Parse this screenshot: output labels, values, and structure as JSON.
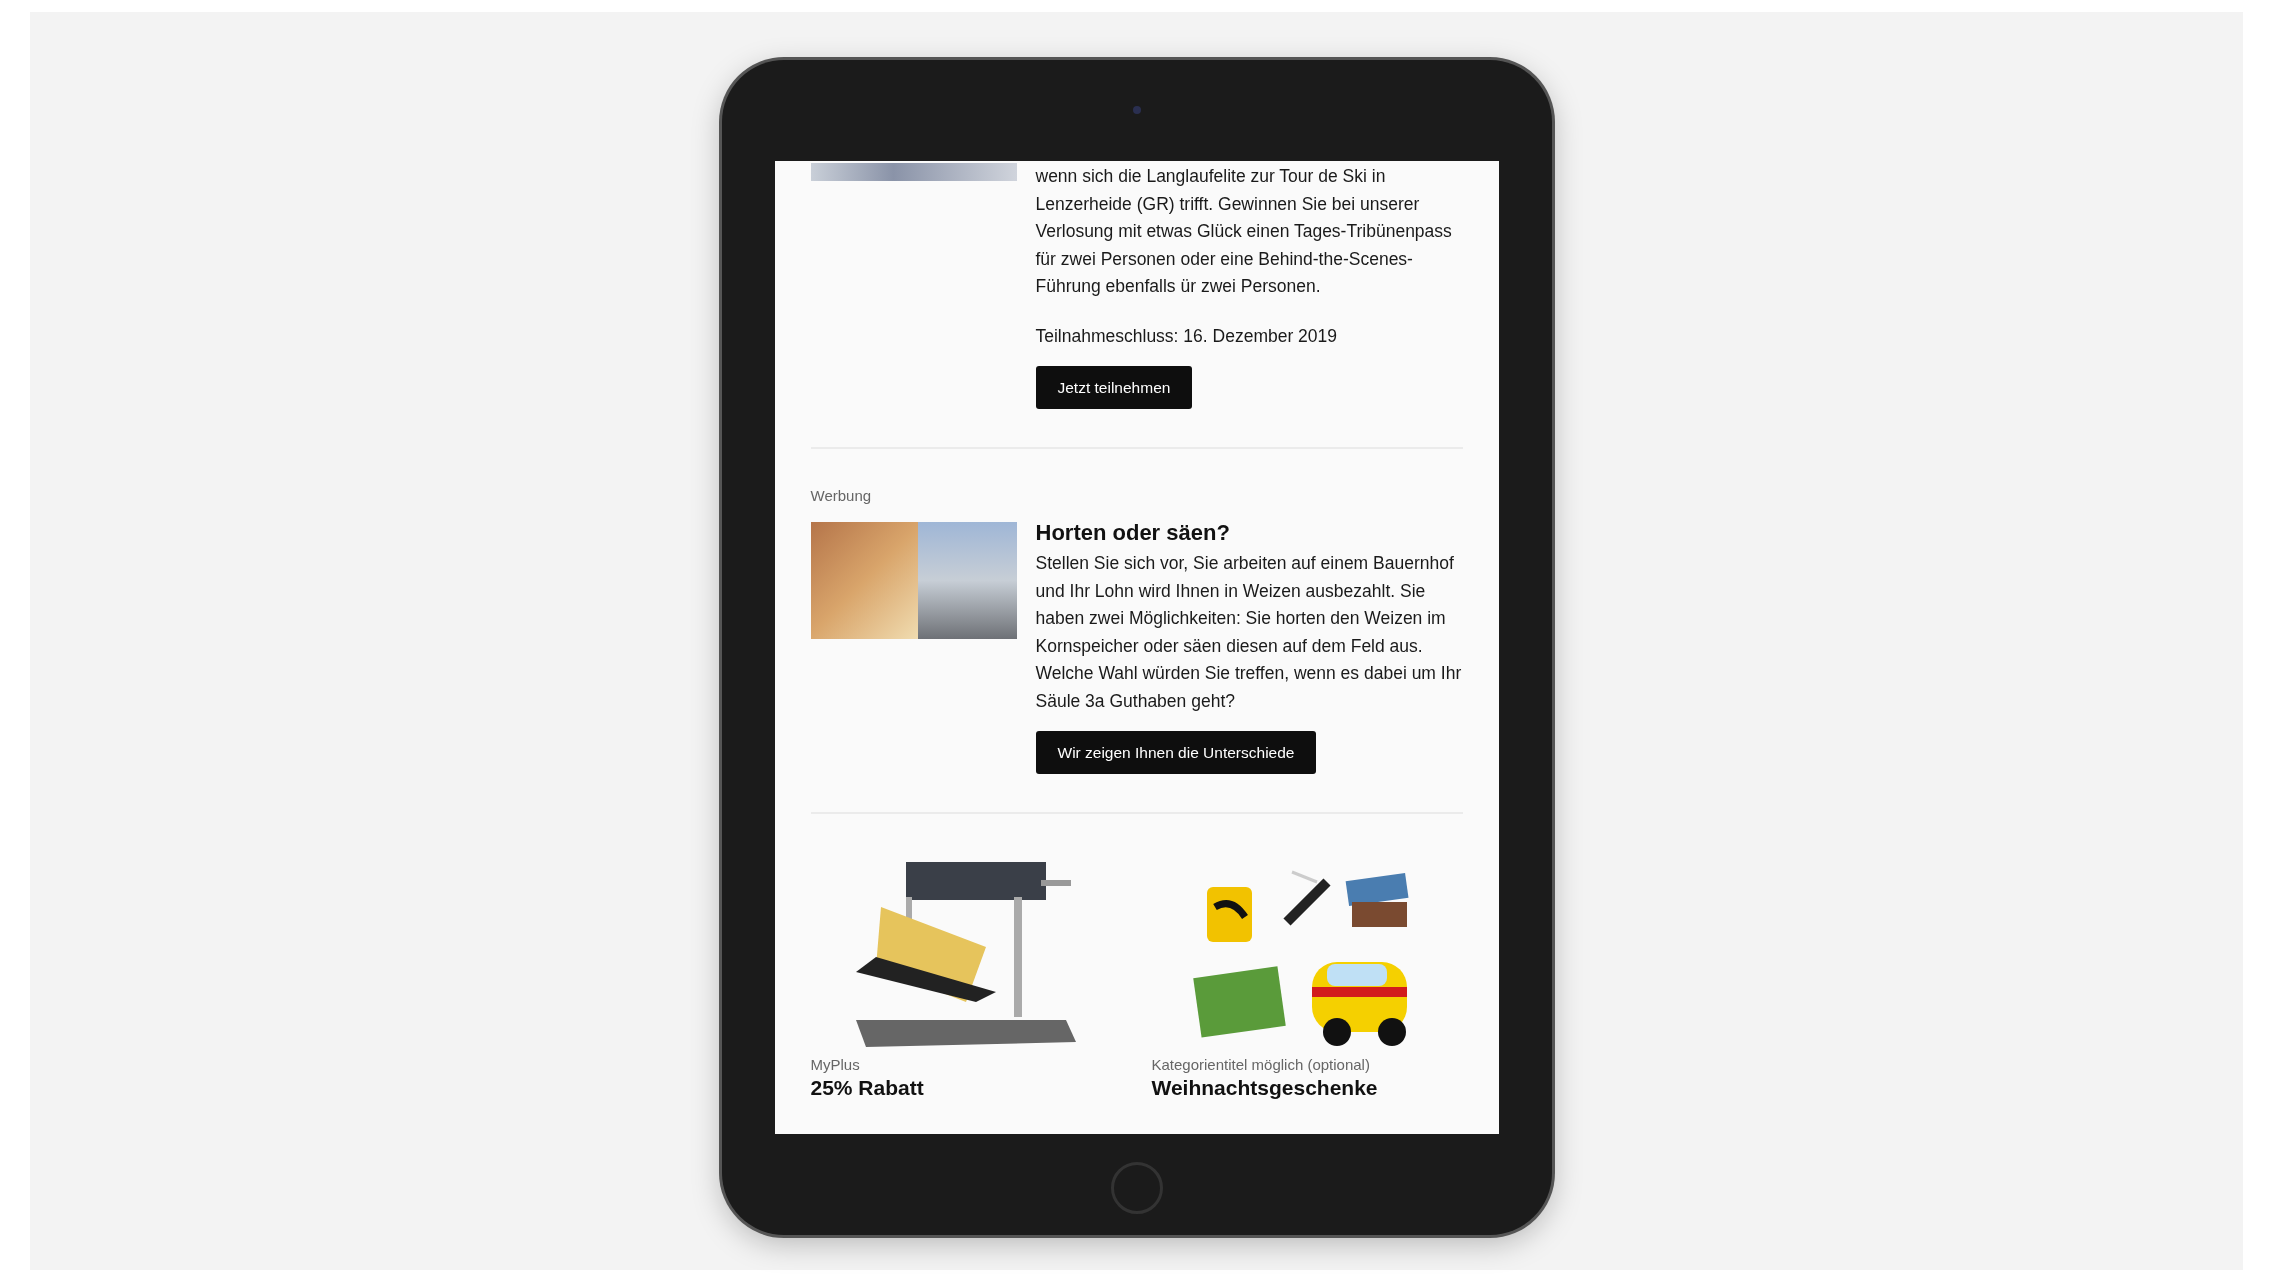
{
  "newsletter": {
    "sections": [
      {
        "kind": "article",
        "paragraphs": [
          "wenn sich die Langlaufelite zur Tour de Ski in Lenzerheide (GR) trifft. Gewinnen Sie bei unserer Verlosung mit etwas Glück einen Tages-Tribünenpass für zwei Personen oder eine Behind-the-Scenes-Führung ebenfalls ür zwei Personen.",
          "Teilnahmeschluss: 16. Dezember 2019"
        ],
        "button": "Jetzt teilnehmen"
      },
      {
        "kind": "article",
        "label": "Werbung",
        "title": "Horten oder säen?",
        "paragraphs": [
          "Stellen Sie sich vor, Sie arbeiten auf einem Bauernhof und Ihr Lohn wird Ihnen in Weizen ausbezahlt. Sie haben zwei Möglichkeiten: Sie horten den Weizen im Kornspeicher oder säen diesen auf dem Feld aus. Welche Wahl würden Sie treffen, wenn es dabei um Ihr Säule 3a Guthaben geht?"
        ],
        "button": "Wir zeigen Ihnen die Unterschiede"
      },
      {
        "kind": "products",
        "items": [
          {
            "category": "MyPlus",
            "title": "25% Rabatt"
          },
          {
            "category": "Kategorientitel möglich (optional)",
            "title": "Weihnachtsgeschenke"
          }
        ]
      }
    ]
  }
}
